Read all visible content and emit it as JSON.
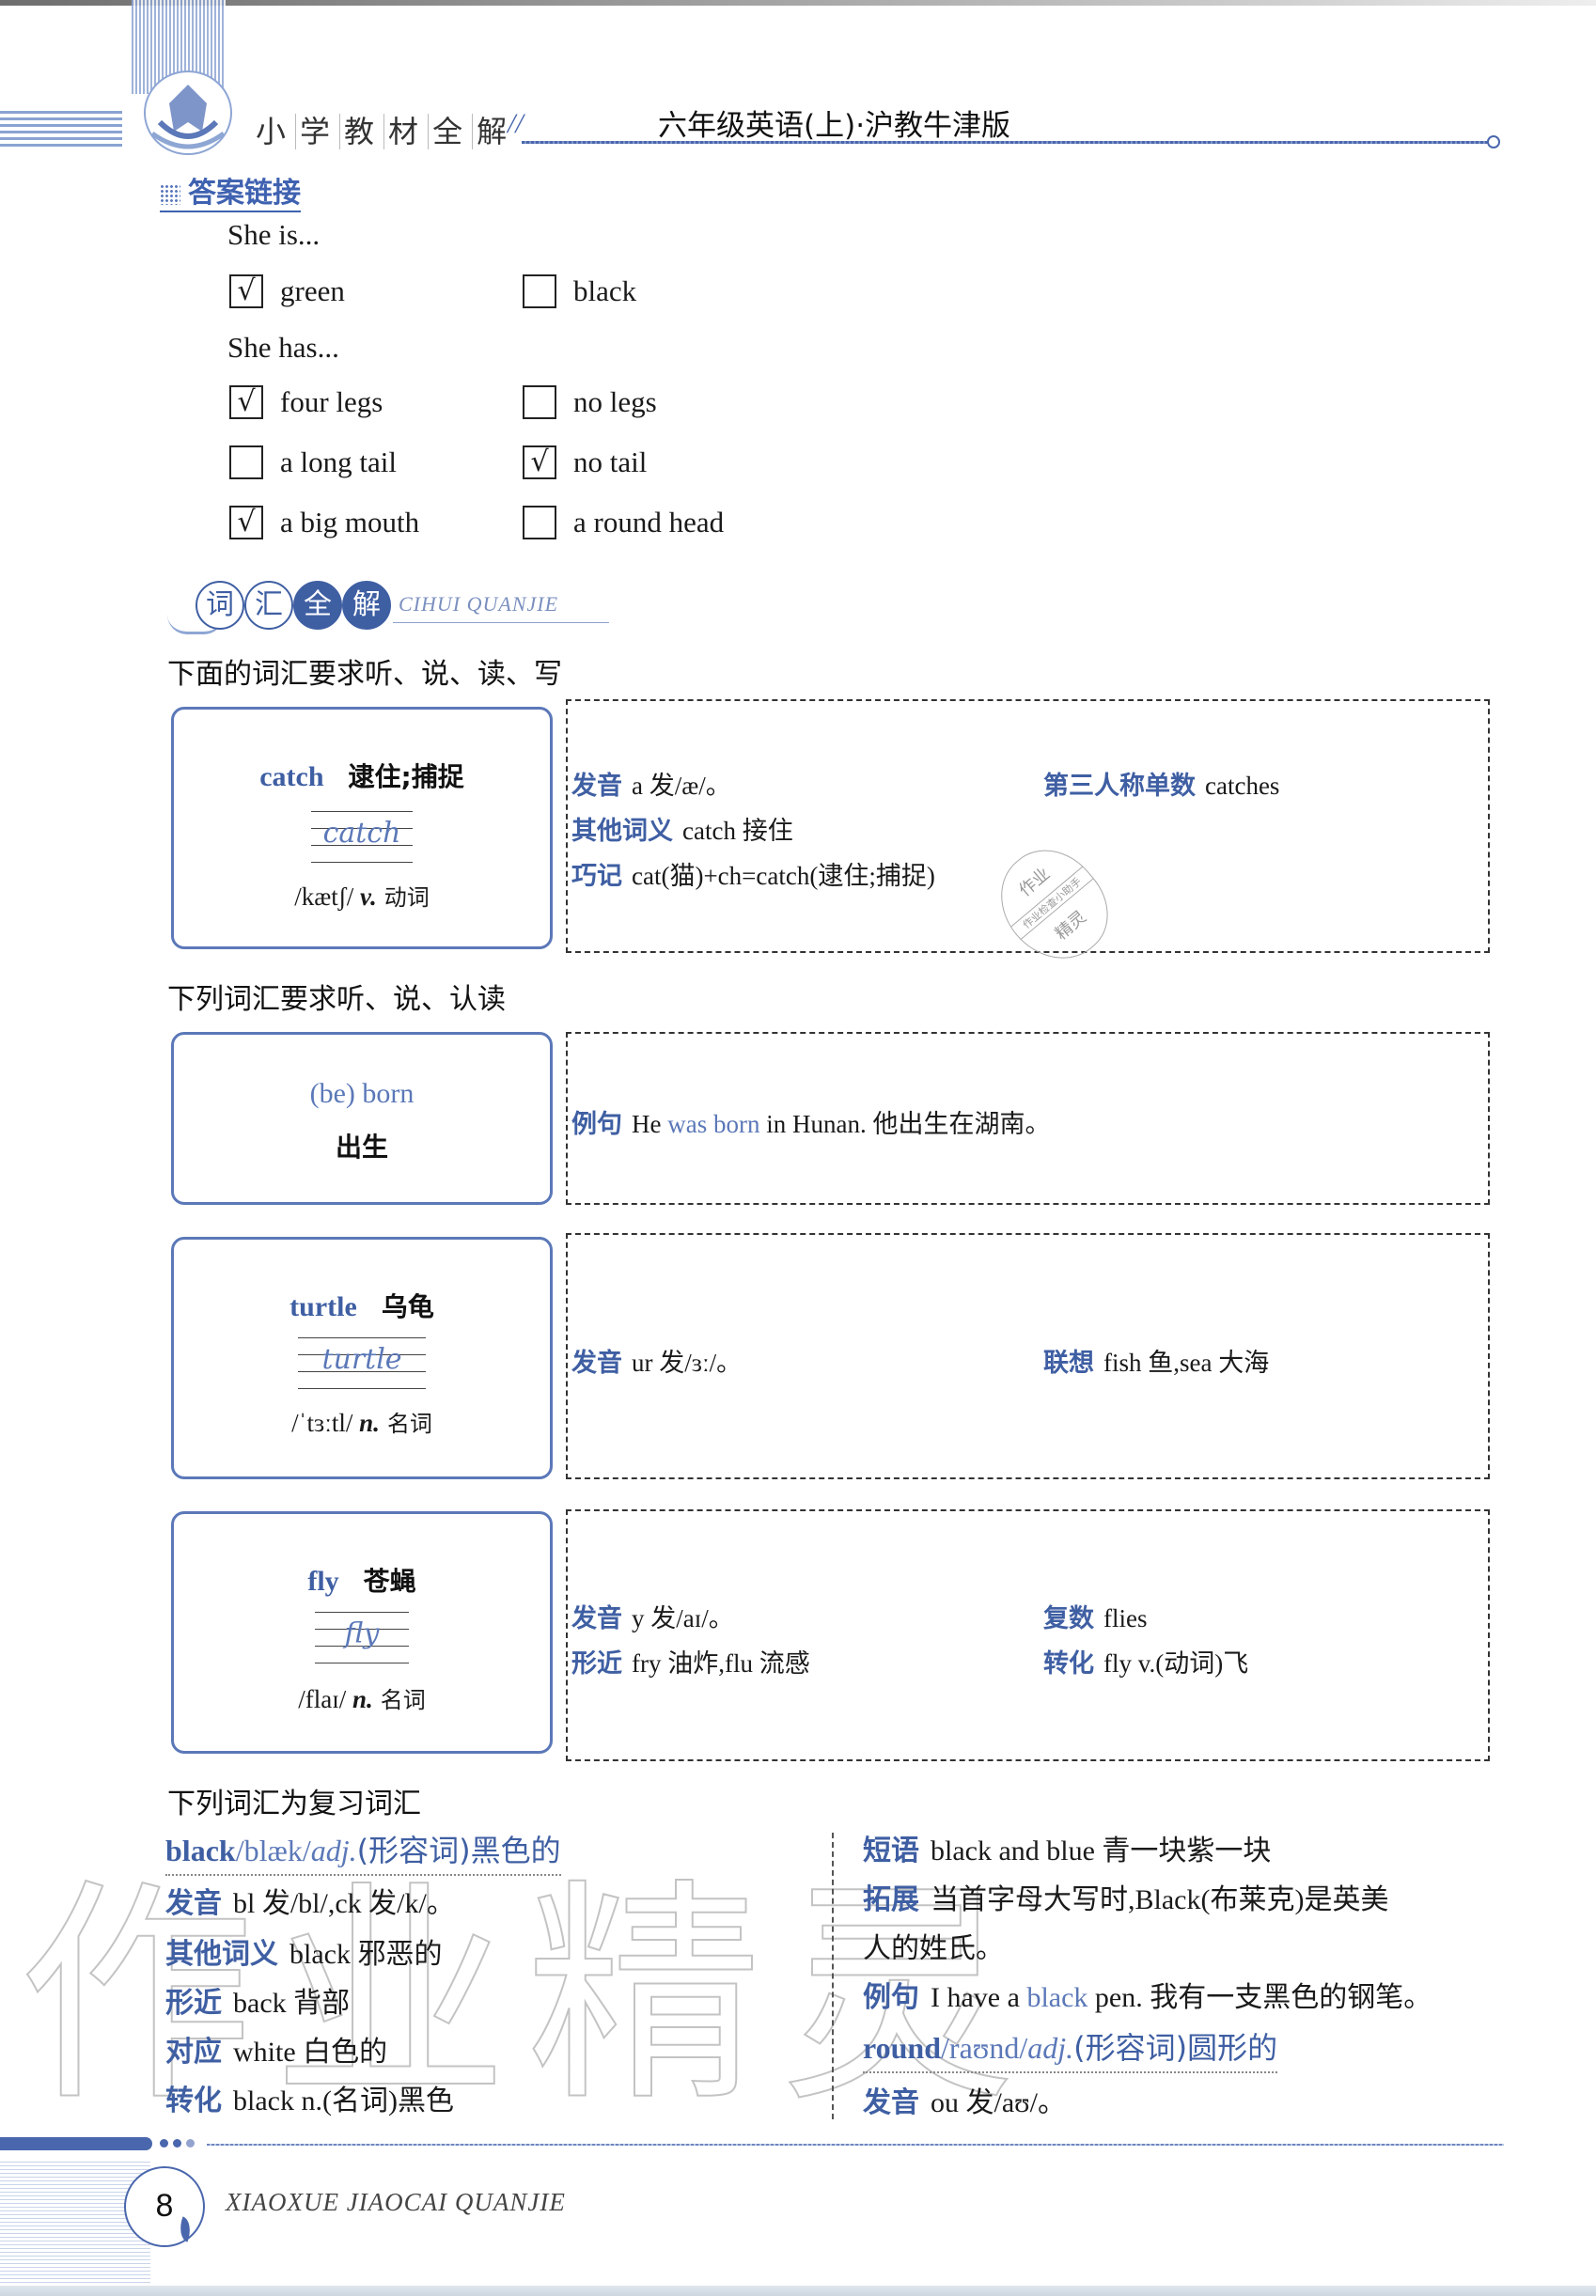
{
  "header": {
    "brand_chars": [
      "小",
      "学",
      "教",
      "材",
      "全",
      "解"
    ],
    "book_title": "六年级英语(上)·沪教牛津版"
  },
  "answer_link": {
    "title": "答案链接",
    "group1_prompt": "She is...",
    "group1": [
      {
        "label": "green",
        "checked": true
      },
      {
        "label": "black",
        "checked": false
      }
    ],
    "group2_prompt": "She has...",
    "group2": [
      {
        "label": "four legs",
        "checked": true
      },
      {
        "label": "no legs",
        "checked": false
      },
      {
        "label": "a long tail",
        "checked": false
      },
      {
        "label": "no tail",
        "checked": true
      },
      {
        "label": "a big mouth",
        "checked": true
      },
      {
        "label": "a round head",
        "checked": false
      }
    ],
    "check_mark": "√"
  },
  "vocab_section": {
    "title_chars": [
      "词",
      "汇",
      "全",
      "解"
    ],
    "subtitle": "CIHUI QUANJIE",
    "req_write": "下面的词汇要求听、说、读、写",
    "req_read": "下列词汇要求听、说、认读",
    "req_review": "下列词汇为复习词汇"
  },
  "cards": [
    {
      "word": "catch",
      "meaning": "逮住;捕捉",
      "handwriting": "catch",
      "phonetic": "/kætʃ/",
      "pos": "v.",
      "pos_cn": "动词",
      "details": [
        {
          "key": "发音",
          "value": "a 发/æ/。"
        },
        {
          "key": "第三人称单数",
          "value": "catches"
        },
        {
          "key": "其他词义",
          "value": "catch 接住"
        },
        {
          "key": "巧记",
          "value": "cat(猫)+ch=catch(逮住;捕捉)"
        }
      ]
    },
    {
      "word": "(be) born",
      "meaning": "出生",
      "details": [
        {
          "key": "例句",
          "pre": "He ",
          "hl": "was born",
          "post": " in Hunan. 他出生在湖南。"
        }
      ]
    },
    {
      "word": "turtle",
      "meaning": "乌龟",
      "handwriting": "turtle",
      "phonetic": "/ˈtɜːtl/",
      "pos": "n.",
      "pos_cn": "名词",
      "details": [
        {
          "key": "发音",
          "value": "ur 发/ɜː/。"
        },
        {
          "key": "联想",
          "value": "fish 鱼,sea 大海"
        }
      ]
    },
    {
      "word": "fly",
      "meaning": "苍蝇",
      "handwriting": "fly",
      "phonetic": "/flaɪ/",
      "pos": "n.",
      "pos_cn": "名词",
      "details": [
        {
          "key": "发音",
          "value": "y 发/aɪ/。"
        },
        {
          "key": "复数",
          "value": "flies"
        },
        {
          "key": "形近",
          "value": "fry 油炸,flu 流感"
        },
        {
          "key": "转化",
          "value": "fly v.(动词)飞"
        }
      ]
    }
  ],
  "review": {
    "black": {
      "word": "black",
      "phonetic": "/blæk/",
      "pos": "adj.",
      "pos_cn": "(形容词)黑色的",
      "rows": [
        {
          "key": "发音",
          "value": "bl 发/bl/,ck 发/k/。"
        },
        {
          "key": "其他词义",
          "value": "black 邪恶的"
        },
        {
          "key": "形近",
          "value": "back 背部"
        },
        {
          "key": "对应",
          "value": "white 白色的"
        },
        {
          "key": "转化",
          "value": "black n.(名词)黑色"
        },
        {
          "key": "短语",
          "value": "black and blue 青一块紫一块"
        },
        {
          "key": "拓展",
          "value": "当首字母大写时,Black(布莱克)是英美",
          "cont": "人的姓氏。"
        },
        {
          "key": "例句",
          "pre": "I have a ",
          "hl": "black",
          "post": " pen. 我有一支黑色的钢笔。"
        }
      ]
    },
    "round": {
      "word": "round",
      "phonetic": "/raʊnd/",
      "pos": "adj.",
      "pos_cn": "(形容词)圆形的",
      "rows": [
        {
          "key": "发音",
          "value": "ou 发/aʊ/。"
        }
      ]
    }
  },
  "stamp": {
    "line1": "作业",
    "line2": "作业检查小助手",
    "line3": "精灵"
  },
  "watermark": "作业精灵",
  "footer": {
    "page_number": "8",
    "series": "XIAOXUE JIAOCAI QUANJIE"
  },
  "colors": {
    "accent_blue": "#3f5fa3",
    "light_blue": "#5b78b8"
  }
}
